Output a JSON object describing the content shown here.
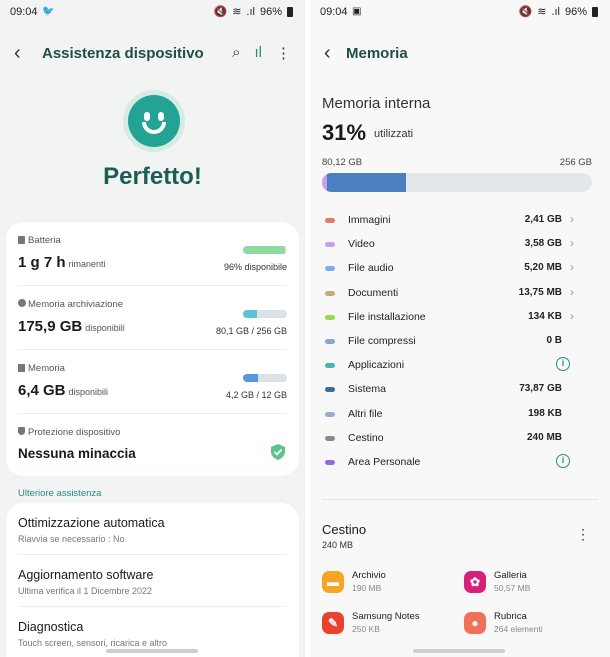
{
  "left": {
    "status": {
      "time": "09:04",
      "battery": "96%"
    },
    "header": {
      "title": "Assistenza dispositivo"
    },
    "hero": {
      "text": "Perfetto!"
    },
    "cards": [
      {
        "label": "Batteria",
        "value": "1 g 7 h",
        "unit": "rimanenti",
        "detail": "96% disponibile",
        "fill": 0.96,
        "color": "#8edba0"
      },
      {
        "label": "Memoria archiviazione",
        "value": "175,9 GB",
        "unit": "disponibili",
        "detail": "80,1 GB / 256 GB",
        "fill": 0.31,
        "color": "#5cc4d0"
      },
      {
        "label": "Memoria",
        "value": "6,4 GB",
        "unit": "disponibili",
        "detail": "4,2 GB / 12 GB",
        "fill": 0.35,
        "color": "#5a96e0"
      },
      {
        "label": "Protezione dispositivo",
        "value": "Nessuna minaccia"
      }
    ],
    "section": {
      "title": "Ulteriore assistenza"
    },
    "items": [
      {
        "title": "Ottimizzazione automatica",
        "subtitle": "Riavvia se necessario : No"
      },
      {
        "title": "Aggiornamento software",
        "subtitle": "Ultima verifica il 1 Dicembre 2022"
      },
      {
        "title": "Diagnostica",
        "subtitle": "Touch screen, sensori, ricarica e altro"
      }
    ]
  },
  "right": {
    "status": {
      "time": "09:04",
      "battery": "96%"
    },
    "header": {
      "title": "Memoria"
    },
    "storage": {
      "label": "Memoria interna",
      "percent": "31%",
      "used_label": "utilizzati",
      "used": "80,12 GB",
      "total": "256 GB",
      "used_fraction": 0.31
    },
    "categories": [
      {
        "name": "Immagini",
        "size": "2,41 GB",
        "color": "#e6796e",
        "action": "chevron"
      },
      {
        "name": "Video",
        "size": "3,58 GB",
        "color": "#c9a0e8",
        "action": "chevron"
      },
      {
        "name": "File audio",
        "size": "5,20 MB",
        "color": "#7aaeee",
        "action": "chevron"
      },
      {
        "name": "Documenti",
        "size": "13,75 MB",
        "color": "#c8a97e",
        "action": "chevron"
      },
      {
        "name": "File installazione",
        "size": "134 KB",
        "color": "#9ad94f",
        "action": "chevron"
      },
      {
        "name": "File compressi",
        "size": "0 B",
        "color": "#86a9cf",
        "action": "none"
      },
      {
        "name": "Applicazioni",
        "size": "",
        "color": "#4ab5b0",
        "action": "info"
      },
      {
        "name": "Sistema",
        "size": "73,87 GB",
        "color": "#3d6d9e",
        "action": "none"
      },
      {
        "name": "Altri file",
        "size": "198 KB",
        "color": "#98afc7",
        "action": "none"
      },
      {
        "name": "Cestino",
        "size": "240 MB",
        "color": "#8a8a8a",
        "action": "none"
      },
      {
        "name": "Area Personale",
        "size": "",
        "color": "#8e6ed6",
        "action": "info"
      }
    ],
    "trash": {
      "title": "Cestino",
      "size": "240 MB"
    },
    "apps": [
      {
        "name": "Archivio",
        "size": "190 MB",
        "color": "#f5a623",
        "icon-name": "folder-icon"
      },
      {
        "name": "Galleria",
        "size": "50,57 MB",
        "color": "#d6207a",
        "icon-name": "gallery-icon"
      },
      {
        "name": "Samsung Notes",
        "size": "250 KB",
        "color": "#e8432f",
        "icon-name": "notes-icon"
      },
      {
        "name": "Rubrica",
        "size": "264 elementi",
        "color": "#f0705a",
        "icon-name": "contacts-icon"
      }
    ]
  }
}
